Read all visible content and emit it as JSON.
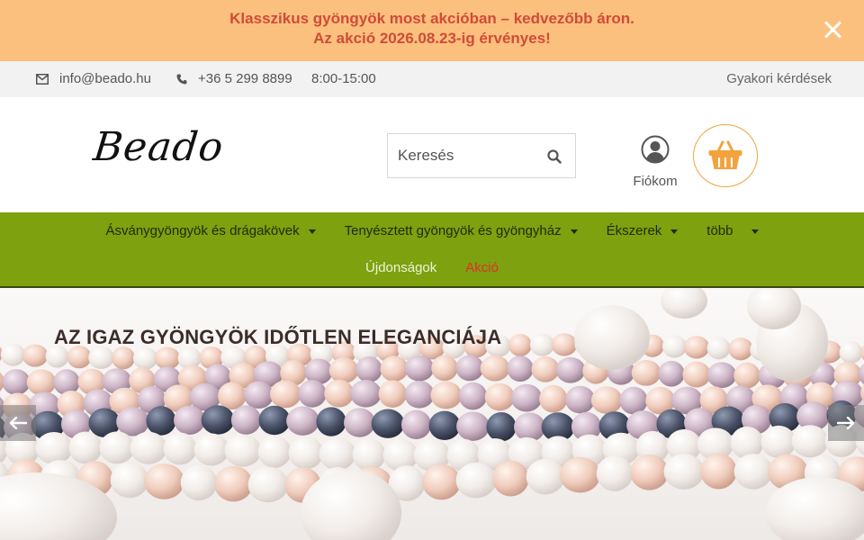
{
  "promo": {
    "line1": "Klasszikus gyöngyök most akcióban – kedvezőbb áron.",
    "line2": "Az akció 2026.08.23-ig érvényes!",
    "close_icon": "close-icon"
  },
  "topbar": {
    "email": "info@beado.hu",
    "phone": "+36 5 299 8899",
    "hours": "8:00-15:00",
    "faq": "Gyakori kérdések"
  },
  "header": {
    "logo": "Beado",
    "search_placeholder": "Keresés",
    "account_label": "Fiókom",
    "cart_icon": "basket-icon"
  },
  "nav": {
    "row1": [
      {
        "label": "Ásványgyöngyök és drágakövek"
      },
      {
        "label": "Tenyésztett gyöngyök és gyöngyház"
      },
      {
        "label": "Ékszerek"
      },
      {
        "label": "több"
      }
    ],
    "row2": [
      {
        "label": "Újdonságok"
      },
      {
        "label": "Akció"
      }
    ]
  },
  "hero": {
    "title": "AZ IGAZ GYÖNGYÖK IDŐTLEN ELEGANCIÁJA"
  },
  "colors": {
    "promo_bg": "#fcc07e",
    "promo_text": "#d04b38",
    "nav_bg": "#7da10f",
    "accent_orange": "#f2a33b",
    "sale_red": "#e0302a"
  }
}
